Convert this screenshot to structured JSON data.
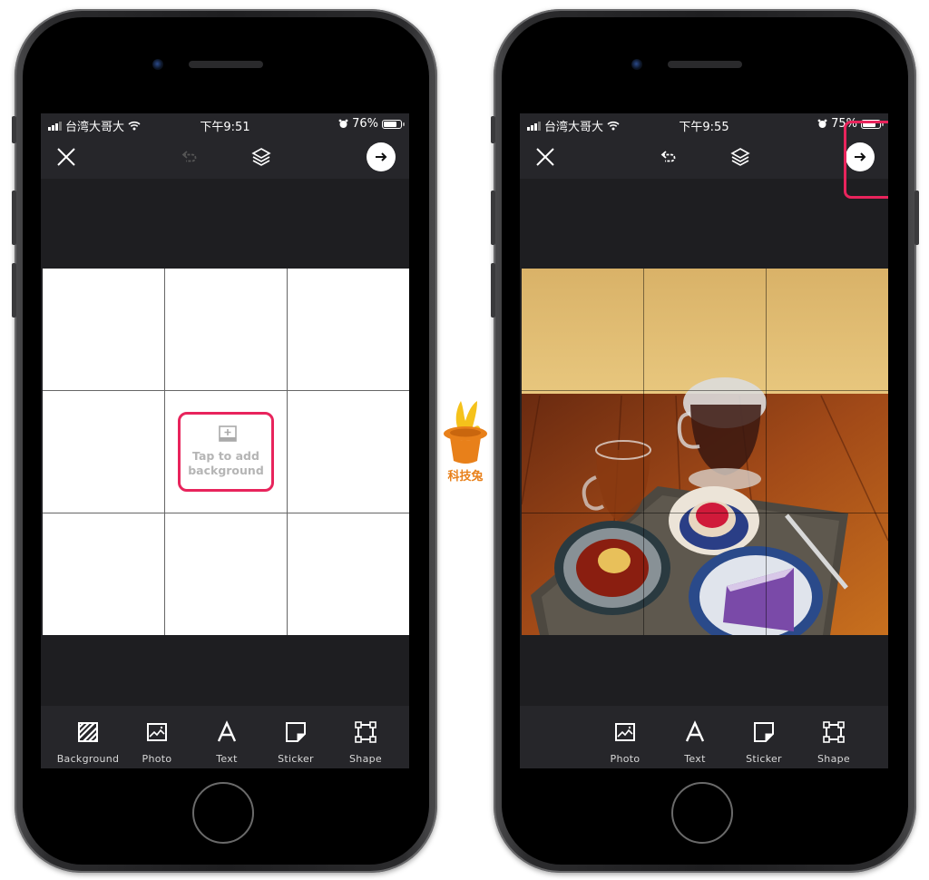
{
  "phones": {
    "left": {
      "status": {
        "carrier": "台湾大哥大",
        "time": "下午9:51",
        "battery": "76%",
        "battery_level": 0.76,
        "alarm_icon": "alarm-icon"
      },
      "toolbar": {
        "close_icon": "close-icon",
        "undo_icon": "undo-icon",
        "undo_enabled": false,
        "layers_icon": "layers-icon",
        "next_icon": "arrow-right-icon"
      },
      "canvas": {
        "placeholder_label": "Tap to add background",
        "placeholder_icon": "add-image-icon",
        "highlighted": true
      },
      "tools": [
        {
          "label": "Background",
          "icon": "background-hatch-icon"
        },
        {
          "label": "Photo",
          "icon": "photo-icon"
        },
        {
          "label": "Text",
          "icon": "text-icon"
        },
        {
          "label": "Sticker",
          "icon": "sticker-icon"
        },
        {
          "label": "Shape",
          "icon": "shape-icon"
        }
      ]
    },
    "right": {
      "status": {
        "carrier": "台湾大哥大",
        "time": "下午9:55",
        "battery": "75%",
        "battery_level": 0.75,
        "alarm_icon": "alarm-icon"
      },
      "toolbar": {
        "close_icon": "close-icon",
        "undo_icon": "undo-icon",
        "undo_enabled": true,
        "layers_icon": "layers-icon",
        "next_icon": "arrow-right-icon",
        "next_highlighted": true
      },
      "canvas": {
        "content": "photo of tea set with cakes on a wooden table"
      },
      "tools": [
        {
          "label": "Photo",
          "icon": "photo-icon"
        },
        {
          "label": "Text",
          "icon": "text-icon"
        },
        {
          "label": "Sticker",
          "icon": "sticker-icon"
        },
        {
          "label": "Shape",
          "icon": "shape-icon"
        }
      ]
    }
  },
  "watermark": {
    "label": "科技兔",
    "icon": "bunny-in-hat-logo"
  },
  "colors": {
    "highlight": "#e8245c",
    "toolbar_bg": "#26262a",
    "screen_bg": "#1e1e21",
    "logo_orange": "#e8801a"
  }
}
